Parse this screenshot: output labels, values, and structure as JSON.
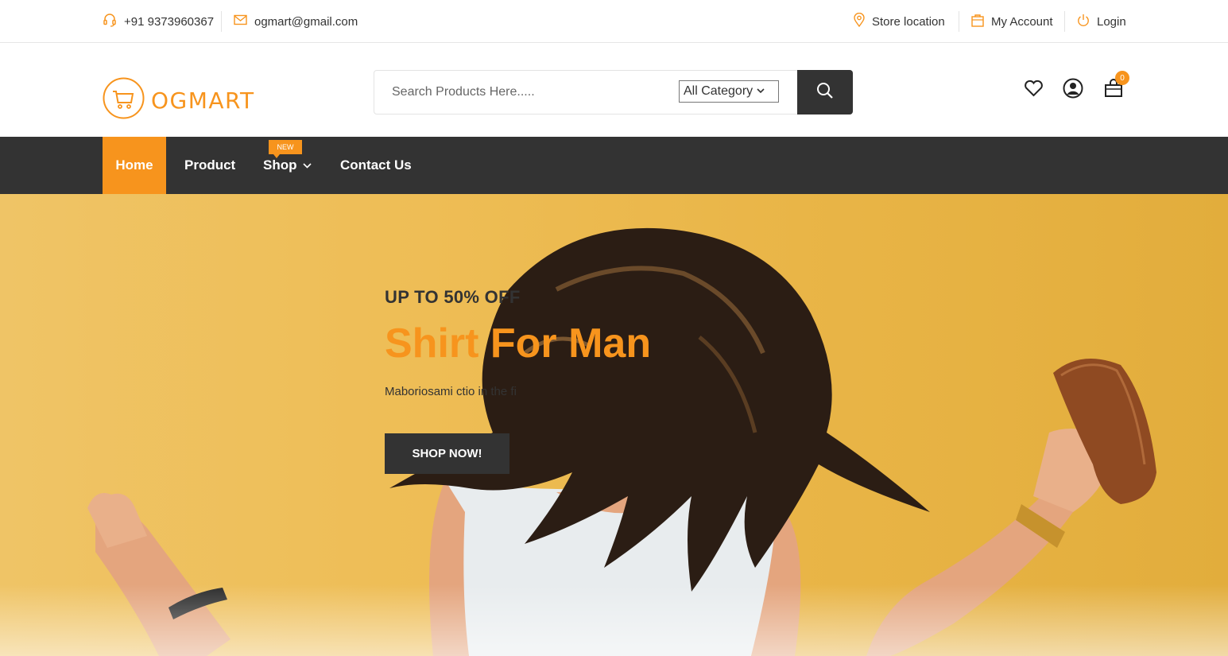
{
  "topbar": {
    "phone": "+91 9373960367",
    "email": "ogmart@gmail.com",
    "store_location": "Store location",
    "my_account": "My Account",
    "login": "Login"
  },
  "header": {
    "logo_text": "OGMART",
    "search": {
      "placeholder": "Search Products Here.....",
      "category": "All Category"
    },
    "cart_count": "0"
  },
  "nav": {
    "items": [
      {
        "label": "Home",
        "active": true
      },
      {
        "label": "Product"
      },
      {
        "label": "Shop",
        "badge": "NEW"
      },
      {
        "label": "Contact Us"
      }
    ]
  },
  "hero": {
    "subtitle": "UP TO 50% OFF",
    "title": "Shirt For Man",
    "text": "Maboriosami ctio in the fi",
    "button": "SHOP NOW!"
  },
  "colors": {
    "accent": "#f7941d",
    "dark": "#333333",
    "hero_bg": "#ebb94e"
  },
  "icons": [
    "headset-icon",
    "envelope-icon",
    "map-pin-icon",
    "bag-icon",
    "power-icon",
    "cart-logo-icon",
    "search-icon",
    "heart-icon",
    "user-icon",
    "shopping-bag-icon",
    "chevron-down-icon"
  ]
}
